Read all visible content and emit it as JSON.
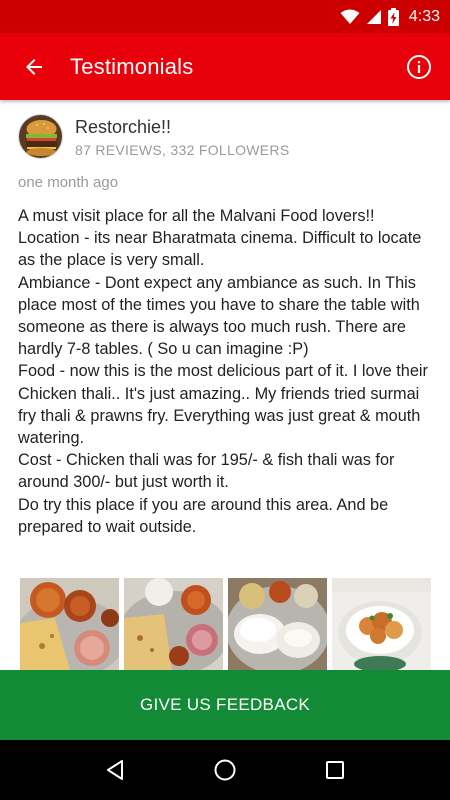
{
  "status_bar": {
    "time": "4:33",
    "icons": [
      "wifi-icon",
      "signal-icon",
      "battery-charging-icon"
    ]
  },
  "app_bar": {
    "title": "Testimonials",
    "back_icon": "arrow-left-icon",
    "info_icon": "info-icon",
    "background_color": "#e8000b"
  },
  "review": {
    "reviewer": {
      "name": "Restorchie!!",
      "stats": "87 REVIEWS, 332 FOLLOWERS",
      "avatar_icon": "burger-avatar"
    },
    "time": "one month ago",
    "paragraphs": [
      "A must visit place for all the Malvani Food lovers!!",
      "Location - its near Bharatmata cinema. Difficult to locate as the place is very small.",
      "Ambiance - Dont expect any ambiance as such. In This place most of the times you have to share the table with someone as there is always too much rush. There are hardly 7-8 tables. ( So u can imagine :P)",
      "Food - now this is the most delicious part of it. I love their Chicken thali.. It's just amazing.. My friends tried surmai fry thali & prawns fry. Everything was just great & mouth watering.",
      "Cost - Chicken thali was for 195/- & fish thali was for around 300/- but just worth it.",
      "Do try this place if you are around this area. And be prepared to wait outside."
    ],
    "photos": [
      "chicken-thali-photo",
      "thali-with-chapati-photo",
      "rice-thali-photo",
      "prawns-fry-photo"
    ]
  },
  "feedback_button": {
    "label": "GIVE US FEEDBACK",
    "color": "#128a36"
  },
  "nav_bar": {
    "icons": [
      "back-triangle-icon",
      "home-circle-icon",
      "recents-square-icon"
    ]
  }
}
